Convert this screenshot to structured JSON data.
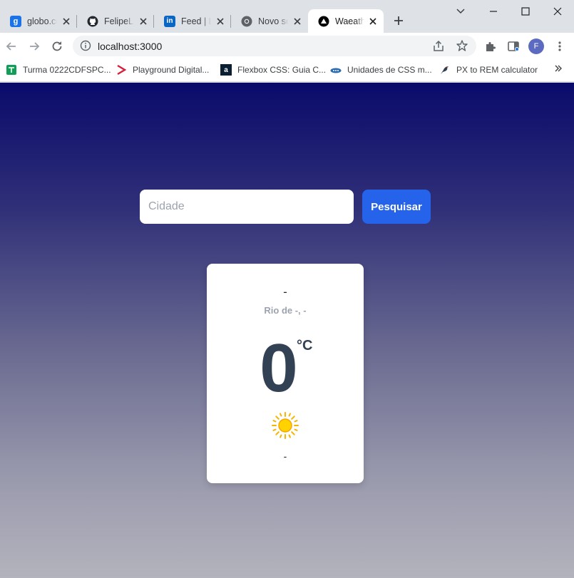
{
  "browser": {
    "tabs": [
      {
        "title": "globo.com",
        "favicon": "g",
        "favicon_color": "#1a73e8"
      },
      {
        "title": "FelipeLe",
        "favicon": "github-icon",
        "favicon_color": "#24292f"
      },
      {
        "title": "Feed | LinkedIn",
        "favicon": "in",
        "favicon_color": "#0a66c2"
      },
      {
        "title": "Novo separador",
        "favicon": "chrome-icon",
        "favicon_color": "#5f6368"
      },
      {
        "title": "Waeather",
        "favicon": "next-icon",
        "favicon_color": "#000000",
        "active": true
      }
    ],
    "url": "localhost:3000",
    "profile_initial": "F",
    "bookmarks": [
      {
        "label": "Turma 0222CDFSPC...",
        "icon": "classroom-icon",
        "color": "#0f9d58"
      },
      {
        "label": "Playground Digital...",
        "icon": "chevron-icon",
        "color": "#d6213c"
      },
      {
        "label": "Flexbox CSS: Guia C...",
        "icon": "a",
        "color": "#0b1f33"
      },
      {
        "label": "Unidades de CSS m...",
        "icon": "dpw-icon",
        "color": "#2b6cb0"
      },
      {
        "label": "PX to REM calculator",
        "icon": "bird-icon",
        "color": "#2c3e50"
      }
    ]
  },
  "search": {
    "placeholder": "Cidade",
    "button_label": "Pesquisar"
  },
  "weather": {
    "description": "-",
    "location": "Rio de -, -",
    "temperature": "0",
    "unit": "°C",
    "icon": "sun-icon",
    "footer": "-"
  },
  "colors": {
    "gradient_top": "#0a0a6b",
    "gradient_bottom": "#b3b3bd",
    "button": "#2563eb",
    "temperature": "#334155"
  }
}
